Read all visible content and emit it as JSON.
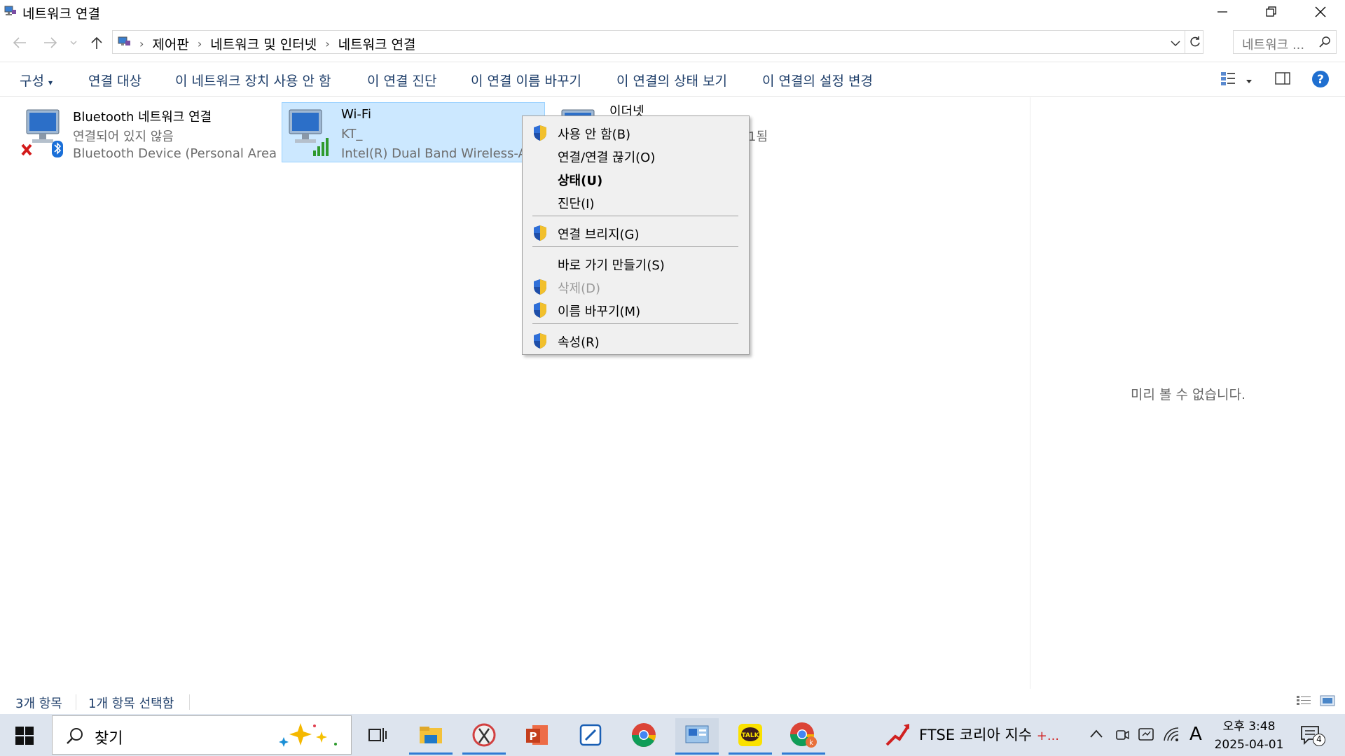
{
  "window": {
    "title": "네트워크 연결"
  },
  "address": {
    "crumbs": [
      "제어판",
      "네트워크 및 인터넷",
      "네트워크 연결"
    ],
    "search_placeholder": "네트워크 ..."
  },
  "commands": [
    "구성",
    "연결 대상",
    "이 네트워크 장치 사용 안 함",
    "이 연결 진단",
    "이 연결 이름 바꾸기",
    "이 연결의 상태 보기",
    "이 연결의 설정 변경"
  ],
  "connections": [
    {
      "name": "Bluetooth 네트워크 연결",
      "status": "연결되어 있지 않음",
      "device": "Bluetooth Device (Personal Area ..."
    },
    {
      "name": "Wi-Fi",
      "status": "KT_",
      "device": "Intel(R) Dual Band Wireless-AC 8"
    },
    {
      "name": "이더넷",
      "status": "1됨",
      "device": ""
    }
  ],
  "context_menu": {
    "items": [
      {
        "label": "사용 안 함(B)",
        "shield": true
      },
      {
        "label": "연결/연결 끊기(O)",
        "shield": false
      },
      {
        "label": "상태(U)",
        "shield": false,
        "bold": true
      },
      {
        "label": "진단(I)",
        "shield": false
      },
      {
        "label": "연결 브리지(G)",
        "shield": true
      },
      {
        "label": "바로 가기 만들기(S)",
        "shield": false
      },
      {
        "label": "삭제(D)",
        "shield": true,
        "disabled": true
      },
      {
        "label": "이름 바꾸기(M)",
        "shield": true
      },
      {
        "label": "속성(R)",
        "shield": true
      }
    ]
  },
  "preview": {
    "message": "미리 볼 수 없습니다."
  },
  "status": {
    "item_count": "3개 항목",
    "selected": "1개 항목 선택함"
  },
  "taskbar": {
    "search_text": "찾기",
    "ftse_text": "FTSE 코리아 지수",
    "ftse_change": "+...",
    "clock_time": "오후 3:48",
    "clock_date": "2025-04-01",
    "notification_count": "4",
    "ime_indicator": "A"
  },
  "colors": {
    "accent": "#2f7bd4",
    "selection": "#cce8ff",
    "taskbar": "#dde4ee"
  }
}
